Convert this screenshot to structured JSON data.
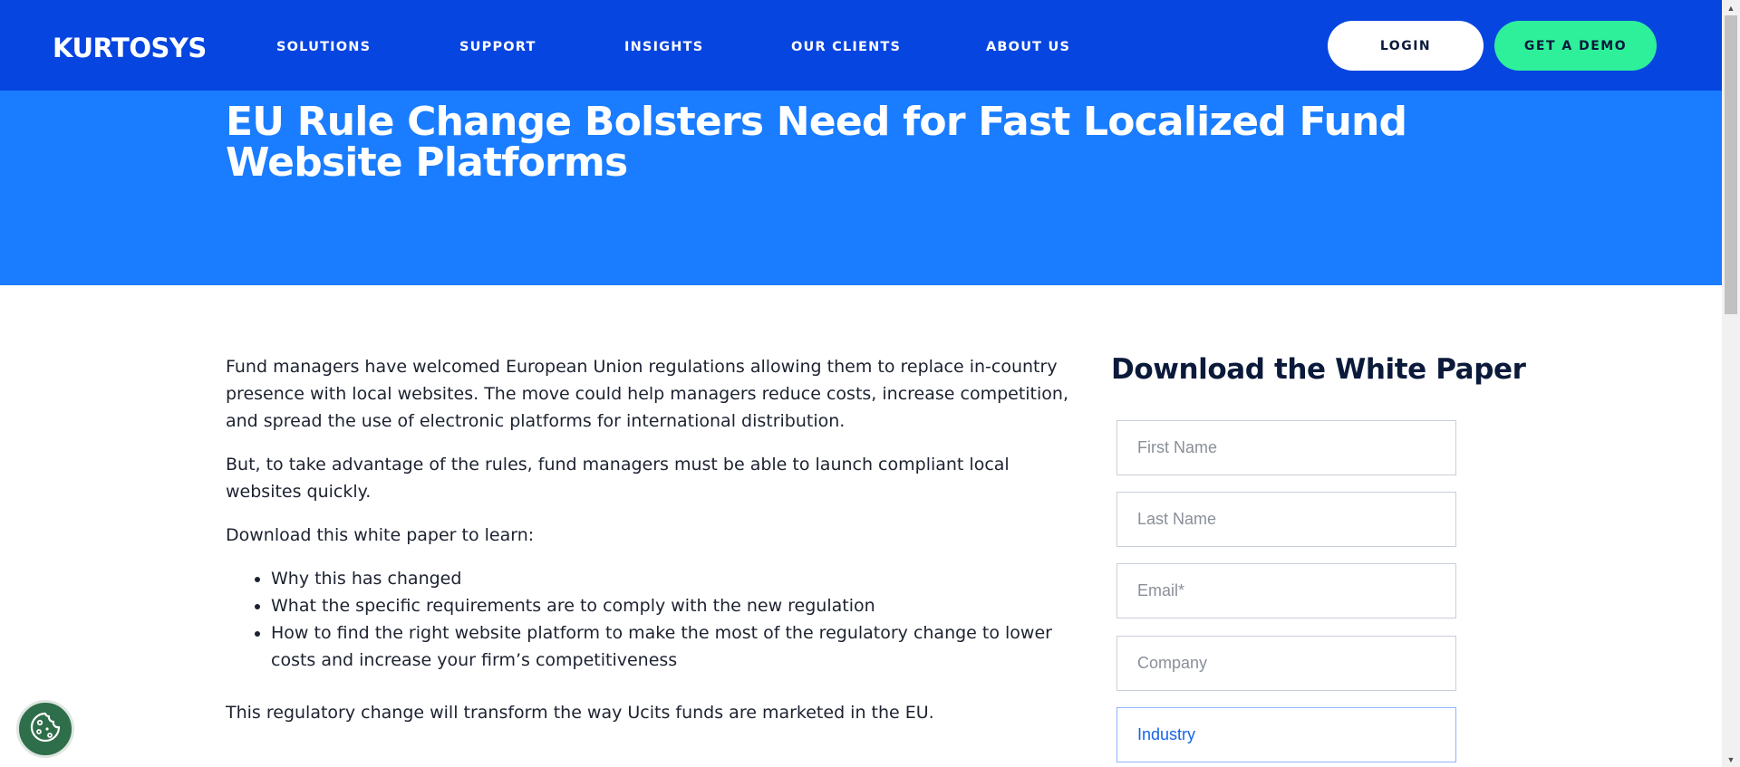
{
  "header": {
    "logo": "KURTOSYS",
    "nav": [
      "SOLUTIONS",
      "SUPPORT",
      "INSIGHTS",
      "OUR CLIENTS",
      "ABOUT US"
    ],
    "login_label": "LOGIN",
    "demo_label": "GET A DEMO"
  },
  "colors": {
    "nav_bg": "#0645e0",
    "hero_bg": "#1a7dff",
    "demo_button": "#2ef09a",
    "cookie_button": "#2f6e4a"
  },
  "hero": {
    "title": "EU Rule Change Bolsters Need for Fast Localized Fund Website Platforms"
  },
  "content": {
    "p1": "Fund managers have welcomed European Union regulations allowing them to replace in-country presence with local websites. The move could help managers reduce costs, increase competition, and spread the use of electronic platforms for international distribution.",
    "p2": "But, to take advantage of the rules, fund managers must be able to launch compliant local websites quickly.",
    "p3": " Download this white paper to learn:",
    "bullets": [
      "Why this has changed",
      "What the specific requirements are to comply with the new regulation",
      "How to find the right website platform to make the most of the regulatory change to lower costs and increase your firm’s competitiveness"
    ],
    "p4": "This regulatory change will transform the way Ucits funds are marketed in the EU."
  },
  "form": {
    "title": "Download the White Paper",
    "first_name_placeholder": "First Name",
    "last_name_placeholder": "Last Name",
    "email_placeholder": "Email*",
    "company_placeholder": "Company",
    "industry_label": "Industry"
  },
  "icons": {
    "cookie": "cookie-icon",
    "scroll_up": "scroll-up-arrow-icon",
    "scroll_down": "scroll-down-arrow-icon"
  }
}
